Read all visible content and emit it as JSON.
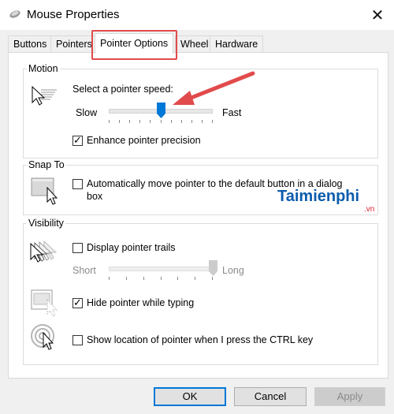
{
  "window": {
    "title": "Mouse Properties",
    "close_glyph": "✕"
  },
  "tabs": [
    {
      "label": "Buttons"
    },
    {
      "label": "Pointers"
    },
    {
      "label": "Pointer Options",
      "active": true
    },
    {
      "label": "Wheel"
    },
    {
      "label": "Hardware"
    }
  ],
  "motion": {
    "heading": "Motion",
    "speed_label": "Select a pointer speed:",
    "slow": "Slow",
    "fast": "Fast",
    "speed_value": 0.5,
    "enhance_label": "Enhance pointer precision",
    "enhance_checked": true
  },
  "snap": {
    "heading": "Snap To",
    "line1": "Automatically move pointer to the default button in a dialog",
    "line2": "box",
    "checked": false
  },
  "visibility": {
    "heading": "Visibility",
    "trails_label": "Display pointer trails",
    "trails_checked": false,
    "short": "Short",
    "long": "Long",
    "trail_value": 1.0,
    "hide_label": "Hide pointer while typing",
    "hide_checked": true,
    "show_label": "Show location of pointer when I press the CTRL key",
    "show_checked": false
  },
  "buttons": {
    "ok": "OK",
    "cancel": "Cancel",
    "apply": "Apply"
  },
  "watermark": {
    "brand": "Taimienphi",
    "domain": ".vn"
  },
  "colors": {
    "highlight": "#e14b4b",
    "accent": "#0078d7"
  },
  "icons": [
    "mouse-icon",
    "close-icon",
    "motion-pointer-icon",
    "snap-to-icon",
    "pointer-trails-icon",
    "hide-pointer-icon",
    "show-location-icon",
    "red-arrow-annotation"
  ]
}
